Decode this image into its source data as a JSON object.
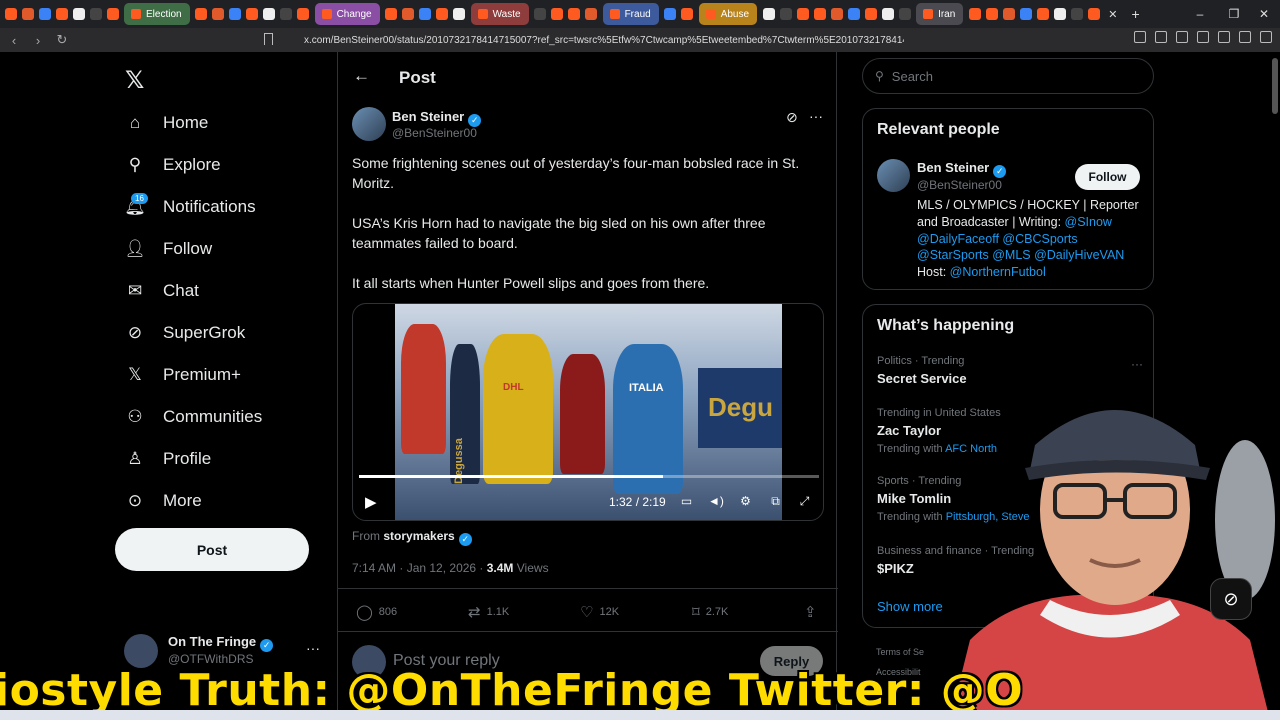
{
  "browser": {
    "tabs": [
      {
        "label": "Election",
        "color": "#3f6e46"
      },
      {
        "label": "Change",
        "color": "#8a4fa5"
      },
      {
        "label": "Waste",
        "color": "#8e3c3c"
      },
      {
        "label": "Fraud",
        "color": "#3d5a9c"
      },
      {
        "label": "Abuse",
        "color": "#b9831c"
      },
      {
        "label": "Iran",
        "color": "#4a4a50"
      }
    ],
    "url": "x.com/BenSteiner00/status/2010732178414715007?ref_src=twsrc%5Etfw%7Ctwcamp%5Etweetembed%7Ctwterm%5E2010732178414715007%...",
    "new_tab_symbol": "+",
    "close_tab_symbol": "✕",
    "win_min": "–",
    "win_max": "❐",
    "win_close": "✕"
  },
  "sidebar": {
    "logo": "𝕏",
    "items": [
      {
        "label": "Home",
        "icon": "home-icon"
      },
      {
        "label": "Explore",
        "icon": "search-icon"
      },
      {
        "label": "Notifications",
        "icon": "bell-icon"
      },
      {
        "label": "Follow",
        "icon": "add-user-icon"
      },
      {
        "label": "Chat",
        "icon": "mail-icon"
      },
      {
        "label": "SuperGrok",
        "icon": "grok-icon"
      },
      {
        "label": "Premium+",
        "icon": "x-icon"
      },
      {
        "label": "Communities",
        "icon": "people-icon"
      },
      {
        "label": "Profile",
        "icon": "person-icon"
      },
      {
        "label": "More",
        "icon": "more-circle-icon"
      }
    ],
    "notifications_badge": "16",
    "post_button": "Post",
    "account": {
      "name": "On The Fringe",
      "handle": "@OTFWithDRS",
      "more": "···"
    }
  },
  "main": {
    "title": "Post",
    "back": "←",
    "tweet": {
      "author_name": "Ben Steiner",
      "author_handle": "@BenSteiner00",
      "more": "···",
      "para1": "Some frightening scenes out of yesterday’s four-man bobsled race in St. Moritz.",
      "para2": "USA’s Kris Horn had to navigate the big sled on his own after three teammates failed to board.",
      "para3": "It all starts when Hunter Powell slips and goes from there.",
      "video": {
        "time": "1:32 / 2:19",
        "progress": 0.66,
        "banner_text": "Degu",
        "side_text": "Degussa",
        "bib_text": "ITALIA",
        "sled_text": "DHL"
      },
      "from_prefix": "From",
      "from_account": "storymakers",
      "time": "7:14 AM · Jan 12, 2026 · ",
      "views_count": "3.4M",
      "views_label": " Views",
      "replies": "806",
      "reposts": "1.1K",
      "likes": "12K",
      "bookmarks": "2.7K"
    },
    "reply_placeholder": "Post your reply",
    "reply_button": "Reply"
  },
  "right": {
    "search_placeholder": "Search",
    "relevant": {
      "title": "Relevant people",
      "name": "Ben Steiner",
      "handle": "@BenSteiner00",
      "follow": "Follow",
      "bio_text": "MLS / OLYMPICS / HOCKEY | Reporter and Broadcaster | Writing: ",
      "bio_links1": "@SInow @DailyFaceoff @CBCSports @StarSports @MLS @DailyHiveVAN",
      "bio_host": "Host: ",
      "bio_link_host": "@NorthernFutbol"
    },
    "happening": {
      "title": "What’s happening",
      "more": "···",
      "trends": [
        {
          "context": "Politics · Trending",
          "title": "Secret Service",
          "with_prefix": "",
          "with_link": ""
        },
        {
          "context": "Trending in United States",
          "title": "Zac Taylor",
          "with_prefix": "Trending with ",
          "with_link": "AFC North"
        },
        {
          "context": "Sports · Trending",
          "title": "Mike Tomlin",
          "with_prefix": "Trending with ",
          "with_link": "Pittsburgh, Steve"
        },
        {
          "context": "Business and finance · Trending",
          "title": "$PIKZ",
          "with_prefix": "",
          "with_link": ""
        }
      ],
      "show_more": "Show more",
      "footer": "Terms of Se",
      "footer2": "Accessibilit"
    }
  },
  "overlay": {
    "banner": "iostyle Truth: @OnTheFringe Twitter: @O",
    "grok_symbol": "⊘"
  }
}
